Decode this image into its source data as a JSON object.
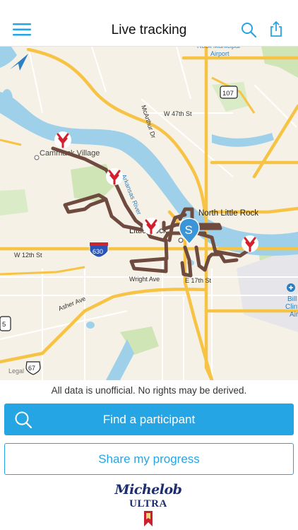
{
  "header": {
    "title": "Live tracking",
    "menu_icon": "hamburger-menu-icon",
    "search_icon": "search-icon",
    "share_icon": "share-icon",
    "accent": "#26a5e4"
  },
  "map": {
    "labels": {
      "airport": "Rock Municipal\nAirport",
      "w47": "W 47th St",
      "mcarthur": "McArthur Dr",
      "village": "Cammack Village",
      "river": "Arkansas River",
      "nlr": "North Little Rock",
      "lr": "Little Rock",
      "w12": "W 12th St",
      "wright": "Wright Ave",
      "e17": "E 17th St",
      "asher": "Asher Ave",
      "clinton": "Bill and H\nClinton Na\nAirport (",
      "legal": "Legal"
    },
    "shields": {
      "i630": "630",
      "us67": "67",
      "hwy107": "107",
      "side5": "5"
    },
    "route_color": "#6f4a3f",
    "marker_color": "#d4202c",
    "tracker_letter": "S"
  },
  "disclaimer": "All data is unofficial. No rights may be derived.",
  "actions": {
    "find_label": "Find a participant",
    "share_label": "Share my progress"
  },
  "sponsor": {
    "line1": "Michelob",
    "line2": "ULTRA"
  }
}
